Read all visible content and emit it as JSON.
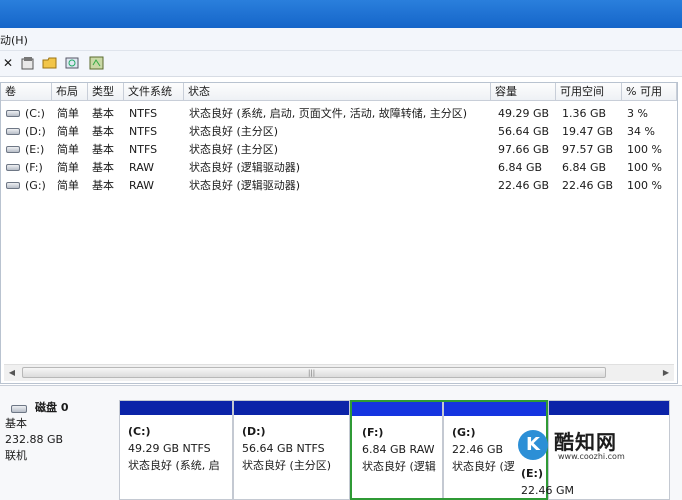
{
  "menu": {
    "partial_label": "动(H)"
  },
  "toolbar": {
    "icons": [
      "close-icon",
      "properties-icon",
      "open-folder-icon",
      "search-volume-icon",
      "help-icon"
    ]
  },
  "columns": [
    "卷",
    "布局",
    "类型",
    "文件系统",
    "状态",
    "容量",
    "可用空间",
    "% 可用"
  ],
  "volumes": [
    {
      "name": "(C:)",
      "layout": "简单",
      "type": "基本",
      "fs": "NTFS",
      "status": "状态良好 (系统, 启动, 页面文件, 活动, 故障转储, 主分区)",
      "capacity": "49.29 GB",
      "free": "1.36 GB",
      "pct": "3 %"
    },
    {
      "name": "(D:)",
      "layout": "简单",
      "type": "基本",
      "fs": "NTFS",
      "status": "状态良好 (主分区)",
      "capacity": "56.64 GB",
      "free": "19.47 GB",
      "pct": "34 %"
    },
    {
      "name": "(E:)",
      "layout": "简单",
      "type": "基本",
      "fs": "NTFS",
      "status": "状态良好 (主分区)",
      "capacity": "97.66 GB",
      "free": "97.57 GB",
      "pct": "100 %"
    },
    {
      "name": "(F:)",
      "layout": "简单",
      "type": "基本",
      "fs": "RAW",
      "status": "状态良好 (逻辑驱动器)",
      "capacity": "6.84 GB",
      "free": "6.84 GB",
      "pct": "100 %"
    },
    {
      "name": "(G:)",
      "layout": "简单",
      "type": "基本",
      "fs": "RAW",
      "status": "状态良好 (逻辑驱动器)",
      "capacity": "22.46 GB",
      "free": "22.46 GB",
      "pct": "100 %"
    }
  ],
  "disk": {
    "name": "磁盘 0",
    "type": "基本",
    "size": "232.88 GB",
    "state": "联机"
  },
  "partitions": [
    {
      "label": "(C:)",
      "size": "49.29 GB NTFS",
      "status": "状态良好 (系统, 启"
    },
    {
      "label": "(D:)",
      "size": "56.64 GB NTFS",
      "status": "状态良好 (主分区)"
    },
    {
      "label": "(F:)",
      "size": "6.84 GB RAW",
      "status": "状态良好 (逻辑"
    },
    {
      "label": "(G:)",
      "size": "22.46 GB",
      "status": "状态良好 (逻"
    },
    {
      "label": "(E:)",
      "size": "22.46 GM",
      "status": ""
    }
  ],
  "watermark": {
    "title": "酷知网",
    "url": "www.coozhi.com"
  },
  "colors": {
    "title_bar": "#1565c9",
    "partition_band": "#0b23a8",
    "selection_border": "#2f9a35"
  }
}
